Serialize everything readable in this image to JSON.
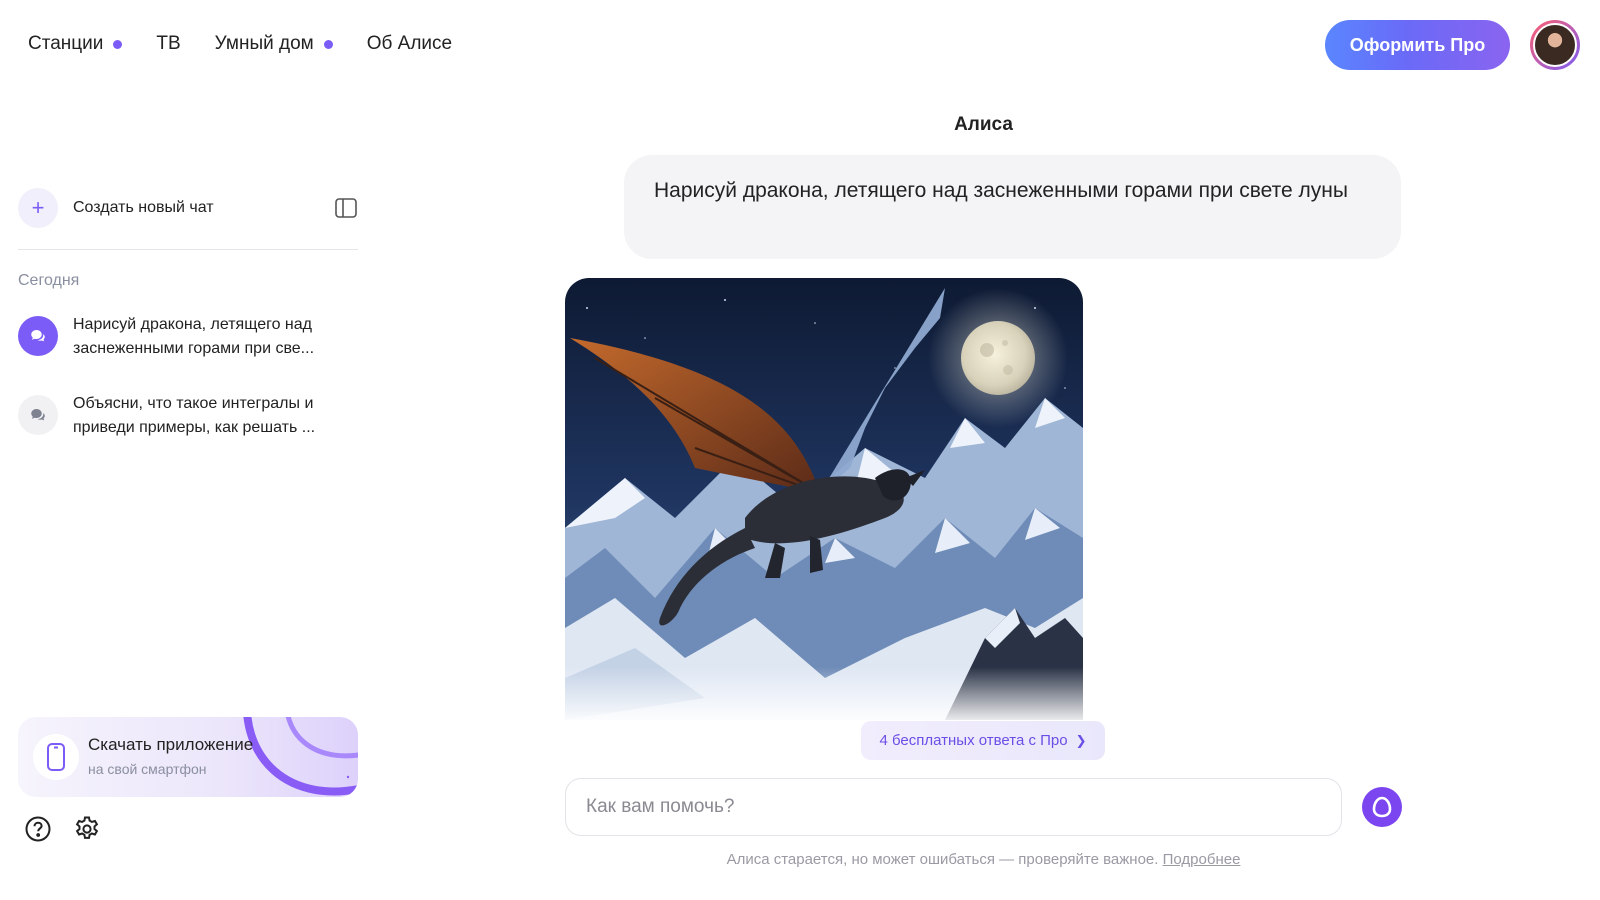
{
  "nav": {
    "items": [
      {
        "label": "Станции",
        "dot": true
      },
      {
        "label": "ТВ",
        "dot": false
      },
      {
        "label": "Умный дом",
        "dot": true
      },
      {
        "label": "Об Алисе",
        "dot": false
      }
    ],
    "pro_button": "Оформить Про"
  },
  "sidebar": {
    "new_chat": "Создать новый чат",
    "section_today": "Сегодня",
    "chats": [
      {
        "title": "Нарисуй дракона, летящего над заснеженными горами при све...",
        "active": true
      },
      {
        "title": "Объясни, что такое интегралы и приведи примеры, как решать ...",
        "active": false
      }
    ],
    "app_card": {
      "title": "Скачать приложение",
      "subtitle": "на свой смартфон"
    }
  },
  "main": {
    "chat_title": "Алиса",
    "user_message": "Нарисуй дракона, летящего над заснеженными горами при свете луны",
    "pro_chip": "4 бесплатных ответа с Про",
    "input_placeholder": "Как вам помочь?",
    "disclaimer": "Алиса старается, но может ошибаться — проверяйте важное.",
    "disclaimer_link": "Подробнее"
  },
  "colors": {
    "accent": "#7b5cf6",
    "pro_gradient_start": "#5a86ff",
    "pro_gradient_end": "#8a64f0"
  }
}
